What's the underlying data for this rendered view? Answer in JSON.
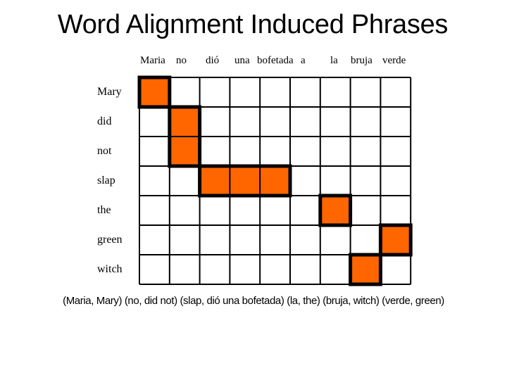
{
  "title": "Word Alignment Induced Phrases",
  "colors": {
    "aligned_fill": "#ff6600",
    "grid_line": "#000000",
    "background": "#ffffff"
  },
  "source_words": [
    "Maria",
    "no",
    "dió",
    "una",
    "bofetada",
    "a",
    "la",
    "bruja",
    "verde"
  ],
  "target_words": [
    "Mary",
    "did",
    "not",
    "slap",
    "the",
    "green",
    "witch"
  ],
  "alignments": [
    {
      "row": 0,
      "col": 0
    },
    {
      "row": 1,
      "col": 1
    },
    {
      "row": 2,
      "col": 1
    },
    {
      "row": 3,
      "col": 2
    },
    {
      "row": 3,
      "col": 3
    },
    {
      "row": 3,
      "col": 4
    },
    {
      "row": 4,
      "col": 6
    },
    {
      "row": 5,
      "col": 8
    },
    {
      "row": 6,
      "col": 7
    }
  ],
  "phrase_boxes": [
    {
      "rows": [
        0,
        0
      ],
      "cols": [
        0,
        0
      ],
      "source": "Maria",
      "target": "Mary"
    },
    {
      "rows": [
        1,
        2
      ],
      "cols": [
        1,
        1
      ],
      "source": "no",
      "target": "did not"
    },
    {
      "rows": [
        3,
        3
      ],
      "cols": [
        2,
        4
      ],
      "source": "dió una bofetada",
      "target": "slap"
    },
    {
      "rows": [
        4,
        4
      ],
      "cols": [
        6,
        6
      ],
      "source": "la",
      "target": "the"
    },
    {
      "rows": [
        5,
        5
      ],
      "cols": [
        8,
        8
      ],
      "source": "verde",
      "target": "green"
    },
    {
      "rows": [
        6,
        6
      ],
      "cols": [
        7,
        7
      ],
      "source": "bruja",
      "target": "witch"
    }
  ],
  "phrase_pairs_text": "(Maria, Mary) (no, did not) (slap, dió una bofetada) (la, the) (bruja, witch) (verde, green)"
}
